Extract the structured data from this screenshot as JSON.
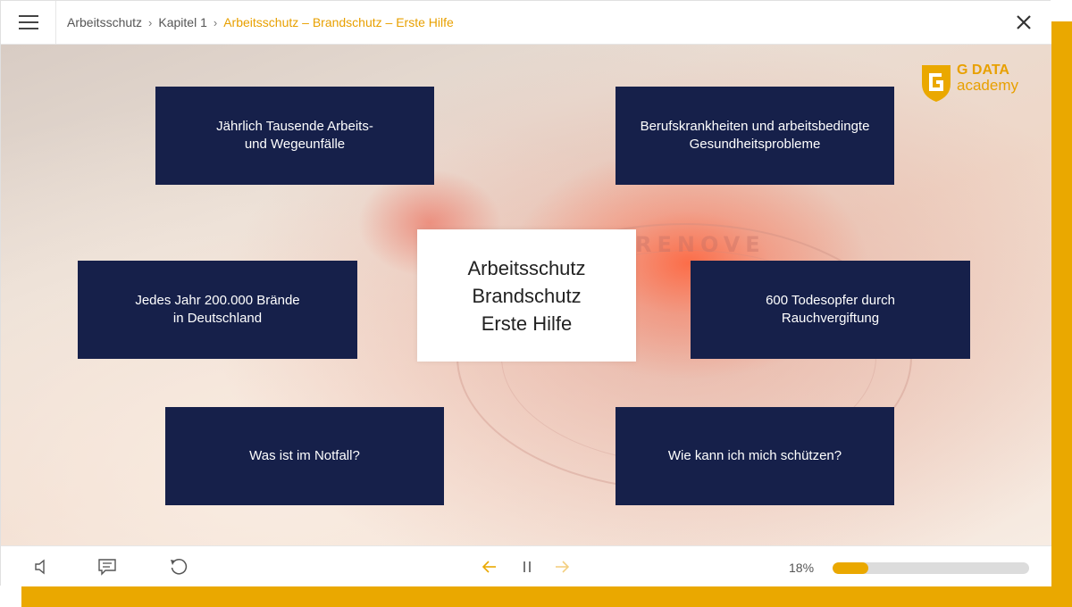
{
  "header": {
    "breadcrumb": [
      "Arbeitsschutz",
      "Kapitel 1",
      "Arbeitsschutz – Brandschutz – Erste Hilfe"
    ],
    "menu_icon": "hamburger-icon",
    "close_icon": "close-icon"
  },
  "logo": {
    "line1": "G DATA",
    "line2": "academy"
  },
  "slide": {
    "center_title": "Arbeitsschutz\nBrandschutz\nErste Hilfe",
    "bubbles": [
      "Jährlich Tausende Arbeits-\nund Wegeunfälle",
      "Berufskrankheiten und arbeitsbedingte\nGesundheitsprobleme",
      "Jedes Jahr 200.000 Brände\nin Deutschland",
      "600 Todesopfer durch\nRauchvergiftung",
      "Was ist im Notfall?",
      "Wie kann ich mich schützen?"
    ],
    "background_text": "RENOVE"
  },
  "footer": {
    "progress_text": "18%",
    "progress_value": 0.18
  },
  "colors": {
    "accent": "#eaa800",
    "bubble": "#16204a"
  }
}
